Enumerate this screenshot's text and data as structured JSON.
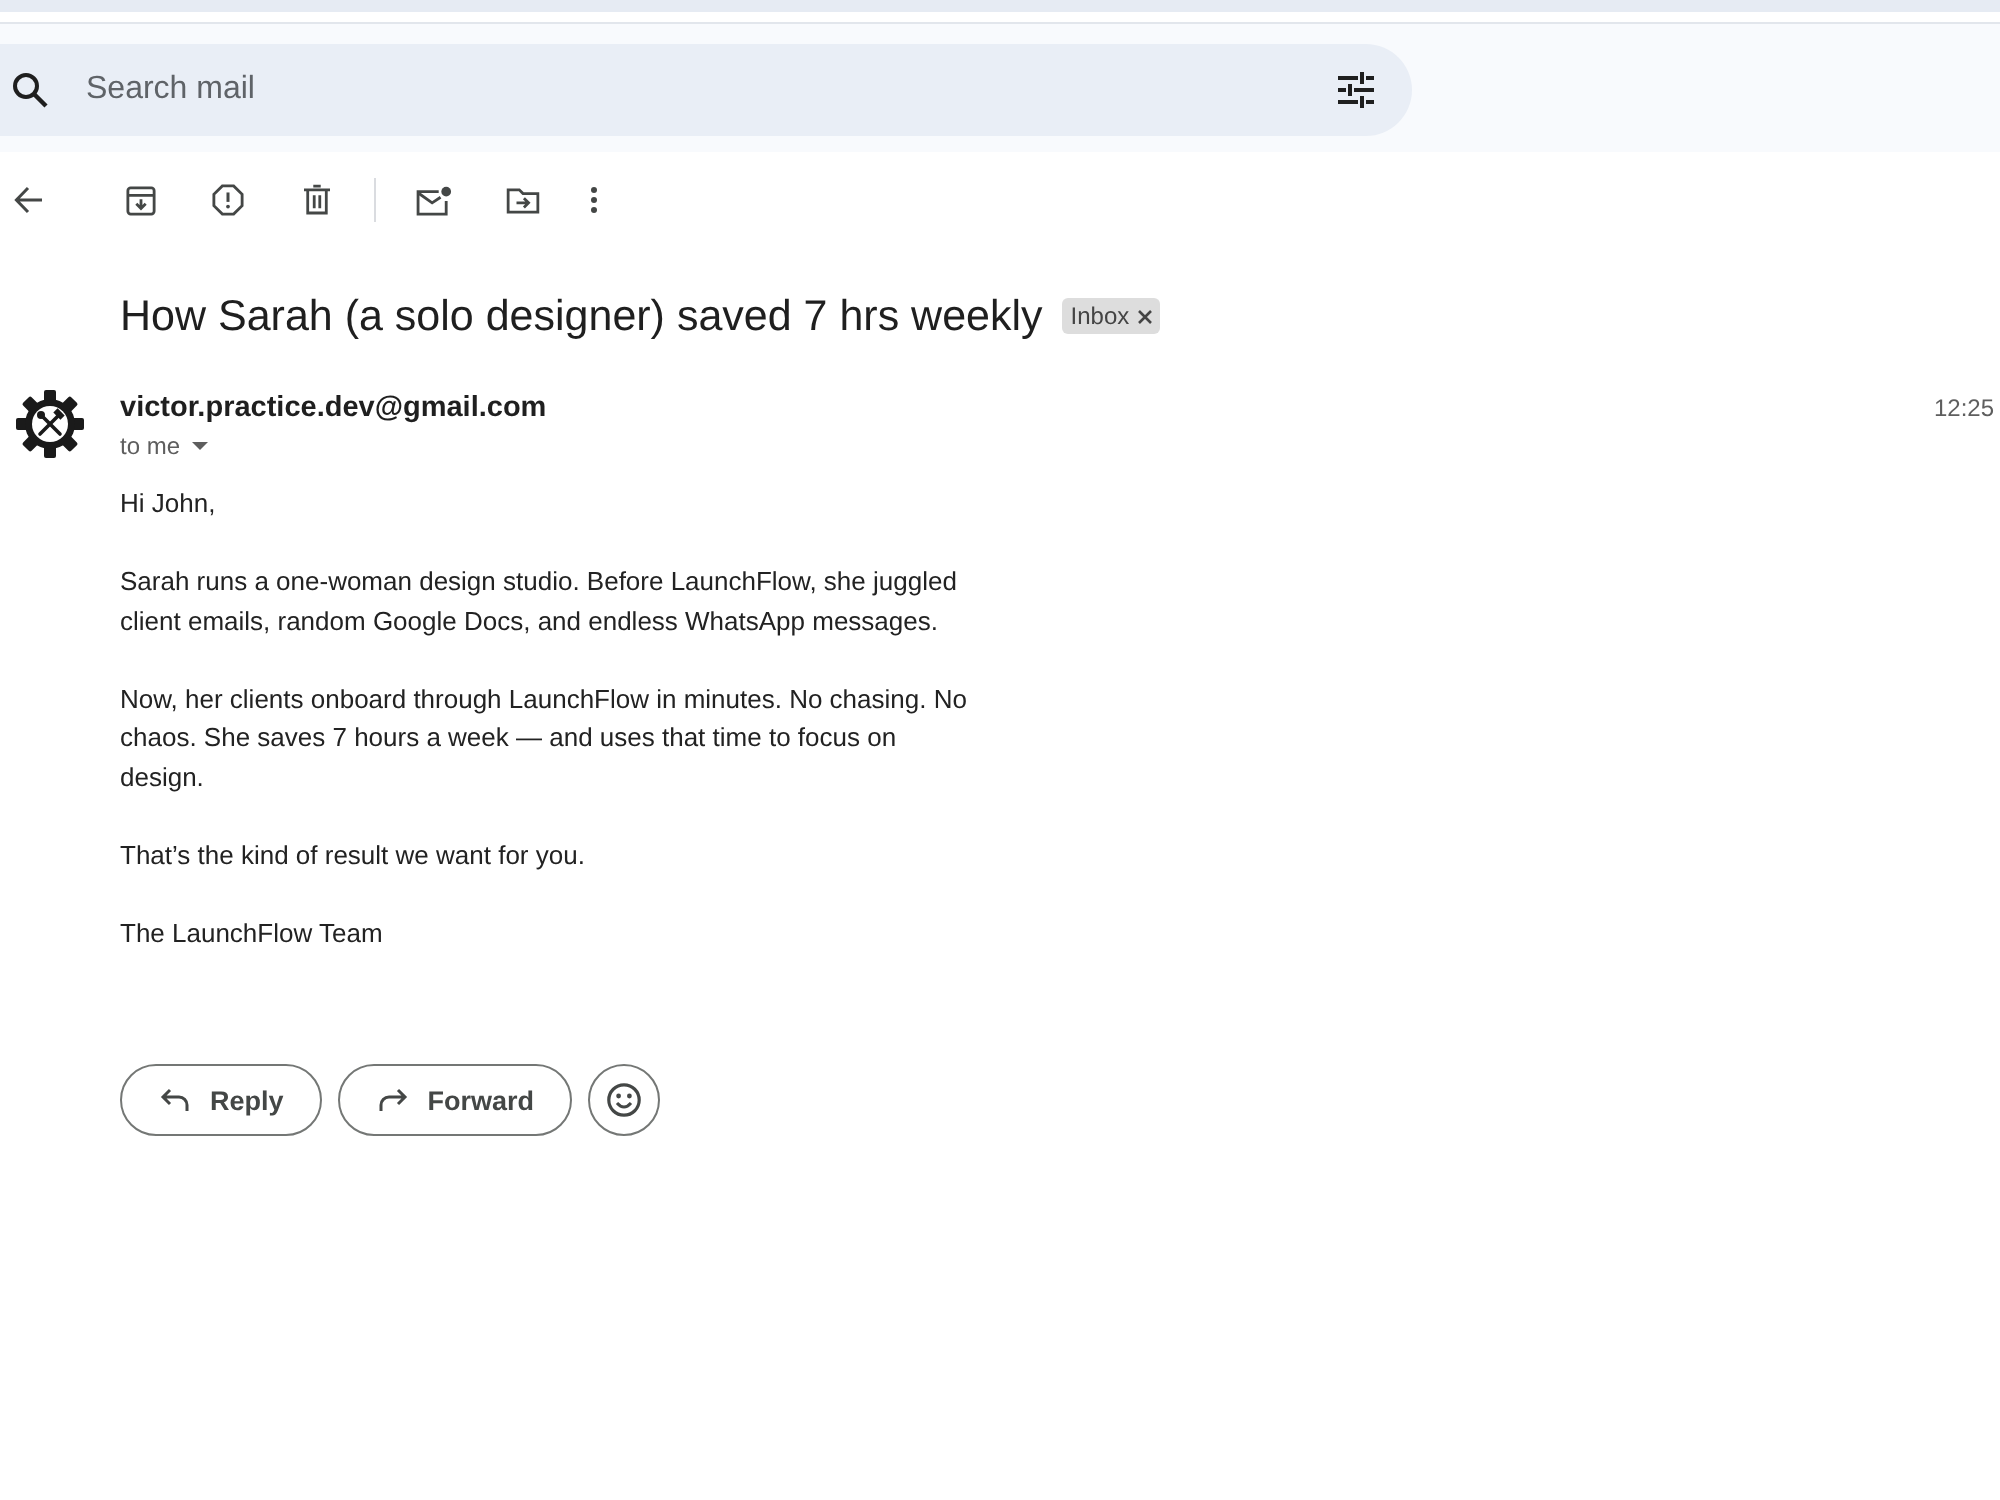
{
  "search": {
    "placeholder": "Search mail"
  },
  "message": {
    "subject": "How Sarah (a solo designer) saved 7 hrs weekly",
    "labels": [
      {
        "label": "Inbox"
      }
    ],
    "sender": "victor.practice.dev@gmail.com",
    "recipient": "to me",
    "time": "12:25",
    "body": [
      "Hi John,",
      "Sarah runs a one-woman design studio. Before LaunchFlow, she juggled client emails, random Google Docs, and endless WhatsApp messages.",
      "Now, her clients onboard through LaunchFlow in minutes. No chasing. No chaos. She saves 7 hours a week — and uses that time to focus on design.",
      "That’s the kind of result we want for you.",
      "The LaunchFlow Team"
    ]
  },
  "actions": [
    {
      "kind": "reply",
      "label": "Reply"
    },
    {
      "kind": "forward",
      "label": "Forward"
    }
  ]
}
